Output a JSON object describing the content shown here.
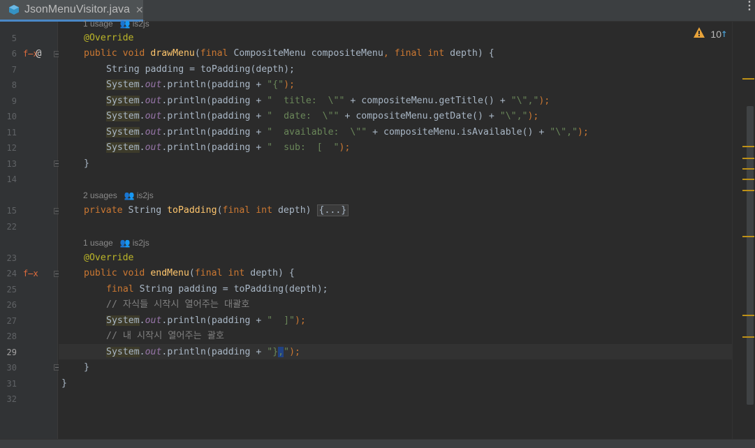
{
  "tab": {
    "file_name": "JsonMenuVisitor.java",
    "close_glyph": "✕",
    "menu_glyph": "⋮"
  },
  "inspection": {
    "warnings": "10",
    "up": "↑",
    "down": "↓"
  },
  "gutter": {
    "line_numbers": [
      "5",
      "6",
      "7",
      "8",
      "9",
      "10",
      "11",
      "12",
      "13",
      "14",
      "15",
      "22",
      "23",
      "24",
      "25",
      "26",
      "27",
      "28",
      "29",
      "30",
      "31",
      "32"
    ],
    "current_line": "29"
  },
  "hints": {
    "h1": {
      "usages": "1 usage",
      "author": "is2js"
    },
    "h2": {
      "usages": "2 usages",
      "author": "is2js"
    },
    "h3": {
      "usages": "1 usage",
      "author": "is2js"
    }
  },
  "code": {
    "override1": "@Override",
    "line6": {
      "kw1": "public",
      "kw2": "void",
      "name": "drawMenu",
      "p1": "(",
      "kw3": "final",
      "t1": " CompositeMenu compositeMenu",
      "c": ", ",
      "kw4": "final",
      "kw5": "int",
      "t2": " depth) {"
    },
    "line7": "String padding = toPadding(depth);",
    "line8": {
      "sys": "System",
      "dot": ".",
      "out": "out",
      "call": ".println(padding + ",
      "str": "\"{\"",
      "end": ");"
    },
    "line9": {
      "sys": "System",
      "dot": ".",
      "out": "out",
      "call": ".println(padding + ",
      "str1": "\"  title:  \\\"\"",
      "mid": " + compositeMenu.getTitle() + ",
      "str2": "\"\\\",\"",
      "end": ");"
    },
    "line10": {
      "sys": "System",
      "dot": ".",
      "out": "out",
      "call": ".println(padding + ",
      "str1": "\"  date:  \\\"\"",
      "mid": " + compositeMenu.getDate() + ",
      "str2": "\"\\\",\"",
      "end": ");"
    },
    "line11": {
      "sys": "System",
      "dot": ".",
      "out": "out",
      "call": ".println(padding + ",
      "str1": "\"  available:  \\\"\"",
      "mid": " + compositeMenu.isAvailable() + ",
      "str2": "\"\\\",\"",
      "end": ");"
    },
    "line12": {
      "sys": "System",
      "dot": ".",
      "out": "out",
      "call": ".println(padding + ",
      "str": "\"  sub:  [  \"",
      "end": ");"
    },
    "line13": "}",
    "line15": {
      "kw": "private",
      "t": " String ",
      "name": "toPadding",
      "p1": "(",
      "kw2": "final",
      "kw3": "int",
      "t2": " depth) ",
      "folded": "{...}"
    },
    "override2": "@Override",
    "line24": {
      "kw1": "public",
      "kw2": "void",
      "name": "endMenu",
      "p1": "(",
      "kw3": "final",
      "kw4": "int",
      "t": " depth) {"
    },
    "line25": {
      "kw": "final",
      "t": " String padding = toPadding(depth);"
    },
    "line26": "// 자식들 시작시 열어주는 대괄호",
    "line27": {
      "sys": "System",
      "dot": ".",
      "out": "out",
      "call": ".println(padding + ",
      "str": "\"  ]\"",
      "end": ");"
    },
    "line28": "// 내 시작시 열어주는 괄호",
    "line29": {
      "sys": "System",
      "dot": ".",
      "out": "out",
      "call": ".println(padding + ",
      "str_a": "\"}",
      "str_sel": ",",
      "str_b": "\"",
      "end": ");"
    },
    "line30": "}",
    "line31": "}"
  },
  "colors": {
    "keyword": "#cc7832",
    "annotation": "#bbb529",
    "method": "#ffc66d",
    "string": "#6a8759",
    "field": "#9876aa",
    "comment": "#808080",
    "marker": "#be9117"
  }
}
